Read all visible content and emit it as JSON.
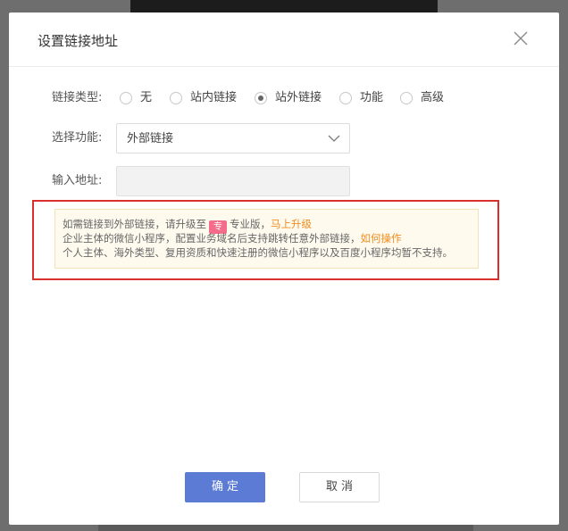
{
  "dialog": {
    "title": "设置链接地址"
  },
  "form": {
    "link_type": {
      "label": "链接类型:",
      "options": [
        {
          "label": "无",
          "checked": false
        },
        {
          "label": "站内链接",
          "checked": false
        },
        {
          "label": "站外链接",
          "checked": true
        },
        {
          "label": "功能",
          "checked": false
        },
        {
          "label": "高级",
          "checked": false
        }
      ]
    },
    "function": {
      "label": "选择功能:",
      "selected": "外部链接"
    },
    "address": {
      "label": "输入地址:",
      "value": "",
      "placeholder": ""
    }
  },
  "notice": {
    "line1_prefix": "如需链接到外部链接，请升级至",
    "badge": "专",
    "line1_suffix": "专业版，",
    "upgrade_link": "马上升级",
    "line2_text": "企业主体的微信小程序，配置业务域名后支持跳转任意外部链接，",
    "howto_link": "如何操作",
    "line3_text": "个人主体、海外类型、复用资质和快速注册的微信小程序以及百度小程序均暂不支持。"
  },
  "buttons": {
    "ok": "确定",
    "cancel": "取消"
  },
  "colors": {
    "primary": "#5b7bd5",
    "link": "#f08c1e",
    "badge": "#f56b8a",
    "highlight": "#d9302c"
  }
}
